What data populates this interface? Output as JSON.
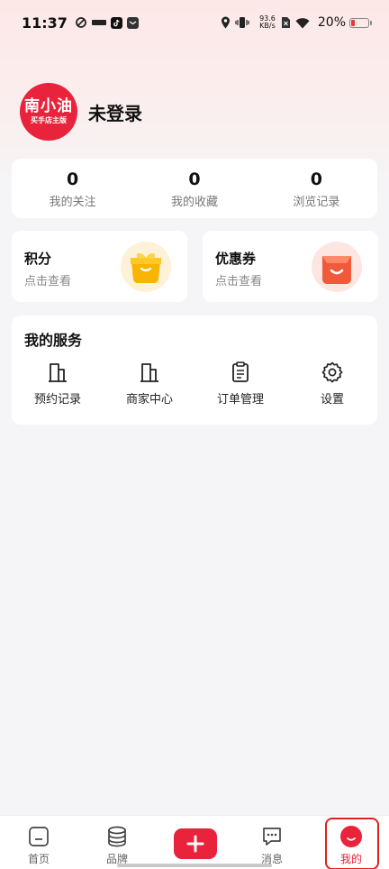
{
  "status_bar": {
    "time": "11:37",
    "net_speed_value": "93.6",
    "net_speed_unit": "KB/s",
    "battery": "20%",
    "battery_level": 0.2
  },
  "profile": {
    "logo_main": "南小油",
    "logo_sub": "买手店主版",
    "login_text": "未登录"
  },
  "stats": [
    {
      "value": "0",
      "label": "我的关注"
    },
    {
      "value": "0",
      "label": "我的收藏"
    },
    {
      "value": "0",
      "label": "浏览记录"
    }
  ],
  "promos": {
    "points": {
      "title": "积分",
      "subtitle": "点击查看",
      "icon": "gift-box-icon"
    },
    "coupons": {
      "title": "优惠券",
      "subtitle": "点击查看",
      "icon": "coupon-icon"
    }
  },
  "services": {
    "title": "我的服务",
    "items": [
      {
        "label": "预约记录",
        "icon": "building-icon"
      },
      {
        "label": "商家中心",
        "icon": "building-icon"
      },
      {
        "label": "订单管理",
        "icon": "clipboard-icon"
      },
      {
        "label": "设置",
        "icon": "gear-icon"
      }
    ]
  },
  "tabbar": {
    "items": [
      {
        "label": "首页",
        "icon": "home-icon"
      },
      {
        "label": "品牌",
        "icon": "stack-icon"
      },
      {
        "label": "",
        "icon": "plus-icon"
      },
      {
        "label": "消息",
        "icon": "chat-bubble-icon"
      },
      {
        "label": "我的",
        "icon": "smile-icon"
      }
    ],
    "active": "我的"
  },
  "colors": {
    "accent": "#e8233b",
    "highlight_border": "#e02020"
  }
}
